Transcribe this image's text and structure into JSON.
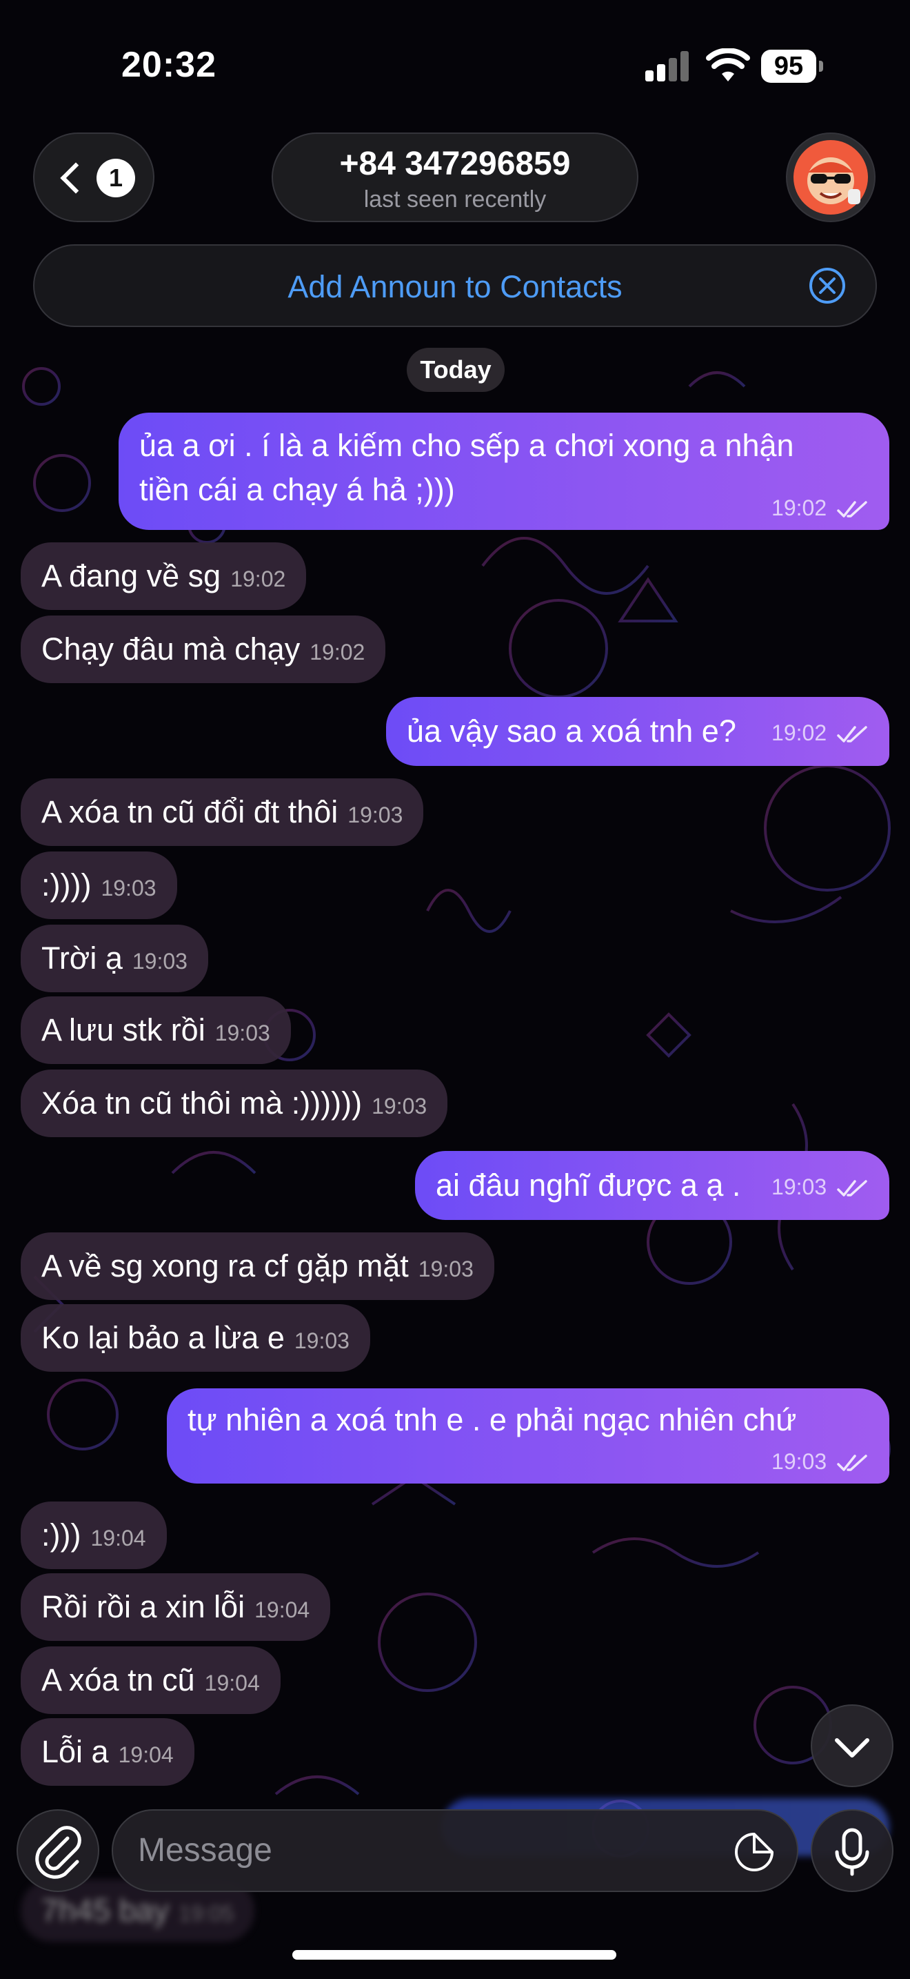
{
  "status_bar": {
    "time": "20:32",
    "battery": "95"
  },
  "header": {
    "back_count": "1",
    "contact_name": "+84 347296859",
    "contact_status": "last seen recently",
    "avatar_icon": "avatar-cartoon-sunglasses"
  },
  "banner": {
    "text": "Add Announ to Contacts"
  },
  "date_divider": "Today",
  "messages": [
    {
      "dir": "out",
      "text_line1": "ủa a ơi . í là a kiếm cho sếp a chơi xong a nhận",
      "text_line2": "tiền cái a chạy á hả ;)))",
      "time": "19:02"
    },
    {
      "dir": "in",
      "text": "A đang về sg",
      "time": "19:02"
    },
    {
      "dir": "in",
      "text": "Chạy đâu mà chạy",
      "time": "19:02"
    },
    {
      "dir": "out",
      "text": "ủa vậy sao a xoá tnh e?",
      "time": "19:02"
    },
    {
      "dir": "in",
      "text": "A xóa tn cũ đổi đt thôi",
      "time": "19:03"
    },
    {
      "dir": "in",
      "text": ":))))",
      "time": "19:03"
    },
    {
      "dir": "in",
      "text": "Trời ạ",
      "time": "19:03"
    },
    {
      "dir": "in",
      "text": "A lưu stk rồi",
      "time": "19:03"
    },
    {
      "dir": "in",
      "text": "Xóa tn cũ thôi mà :))))))",
      "time": "19:03"
    },
    {
      "dir": "out",
      "text": "ai đâu nghĩ được a ạ .",
      "time": "19:03"
    },
    {
      "dir": "in",
      "text": "A về sg xong ra cf gặp mặt",
      "time": "19:03"
    },
    {
      "dir": "in",
      "text": "Ko lại bảo a lừa e",
      "time": "19:03"
    },
    {
      "dir": "out",
      "text": "tự nhiên a xoá tnh e . e phải ngạc nhiên chứ",
      "time": "19:03"
    },
    {
      "dir": "in",
      "text": ":)))",
      "time": "19:04"
    },
    {
      "dir": "in",
      "text": "Rồi rồi a xin lỗi",
      "time": "19:04"
    },
    {
      "dir": "in",
      "text": "A xóa tn cũ",
      "time": "19:04"
    },
    {
      "dir": "in",
      "text": "Lỗi a",
      "time": "19:04"
    },
    {
      "dir": "in",
      "text": "7h45 bay",
      "time": "19:05"
    }
  ],
  "composer": {
    "placeholder": "Message"
  },
  "colors": {
    "accent_blue": "#4e9cf6",
    "outgoing_start": "#6d4cf6",
    "outgoing_end": "#a05cf0",
    "incoming": "#342638"
  }
}
